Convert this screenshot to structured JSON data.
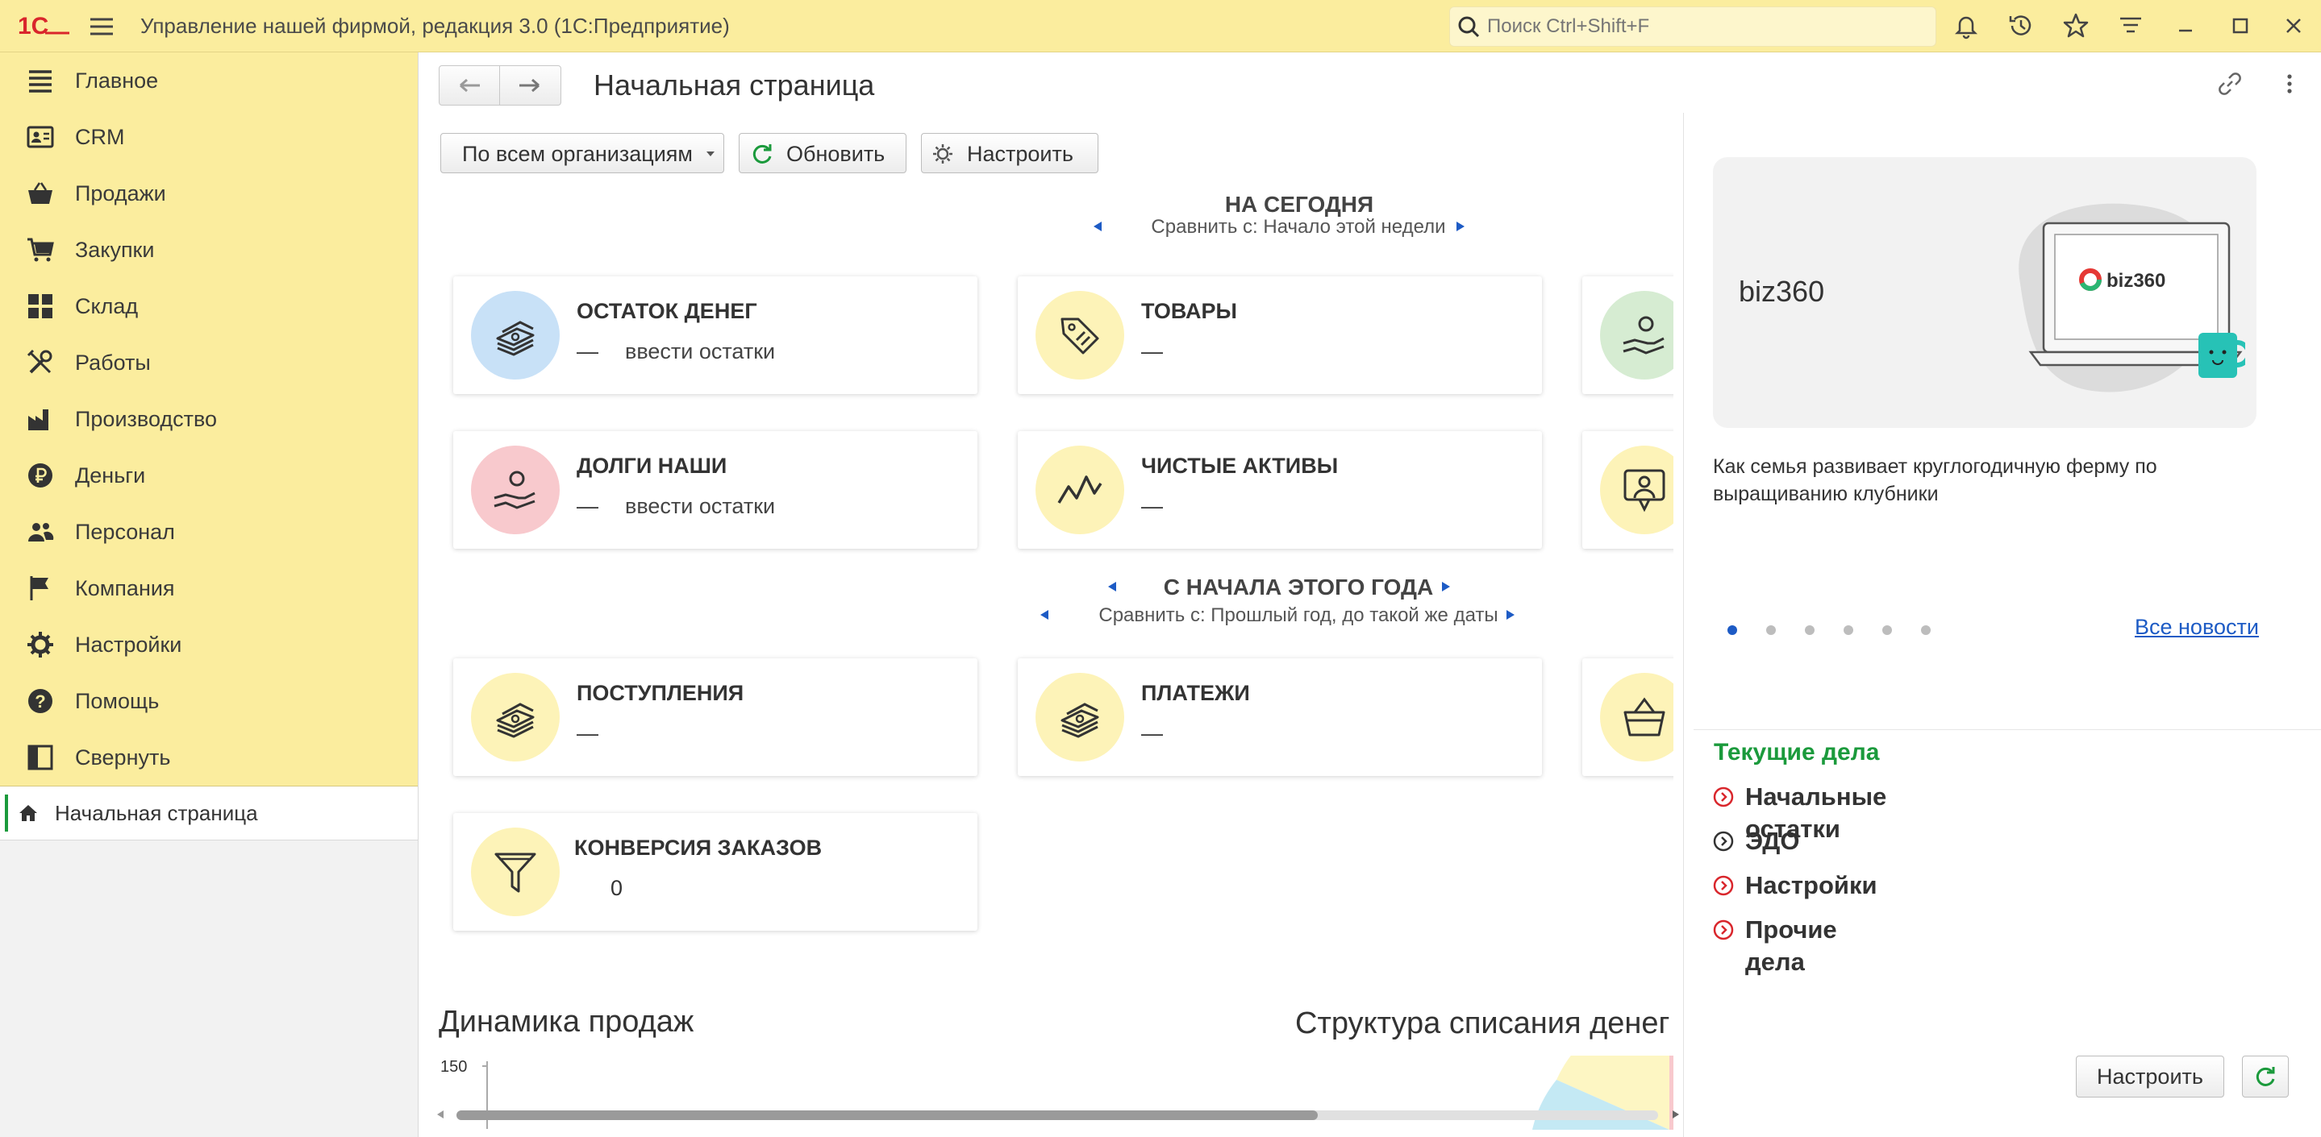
{
  "app": {
    "title": "Управление нашей фирмой, редакция 3.0  (1С:Предприятие)",
    "logo_text": "1С"
  },
  "search": {
    "placeholder": "Поиск Ctrl+Shift+F"
  },
  "sidebar": {
    "sections": [
      {
        "label": "Главное",
        "icon": "list-icon"
      },
      {
        "label": "CRM",
        "icon": "contact-card-icon"
      },
      {
        "label": "Продажи",
        "icon": "basket-icon"
      },
      {
        "label": "Закупки",
        "icon": "cart-icon"
      },
      {
        "label": "Склад",
        "icon": "warehouse-grid-icon"
      },
      {
        "label": "Работы",
        "icon": "tools-icon"
      },
      {
        "label": "Производство",
        "icon": "factory-icon"
      },
      {
        "label": "Деньги",
        "icon": "ruble-icon"
      },
      {
        "label": "Персонал",
        "icon": "people-icon"
      },
      {
        "label": "Компания",
        "icon": "flag-icon"
      },
      {
        "label": "Настройки",
        "icon": "gear-icon"
      },
      {
        "label": "Помощь",
        "icon": "help-icon"
      },
      {
        "label": "Свернуть",
        "icon": "collapse-panel-icon"
      }
    ],
    "open_page": "Начальная страница"
  },
  "main": {
    "title": "Начальная страница",
    "toolbar": {
      "org_select": "По всем организациям",
      "refresh": "Обновить",
      "configure": "Настроить"
    },
    "today": {
      "heading": "НА СЕГОДНЯ",
      "compare": "Сравнить с: Начало этой недели"
    },
    "year": {
      "heading": "С НАЧАЛА ЭТОГО ГОДА",
      "compare": "Сравнить с: Прошлый год, до такой же даты"
    },
    "cards": {
      "cash": {
        "title": "ОСТАТОК ДЕНЕГ",
        "value": "—",
        "note": "ввести остатки"
      },
      "goods": {
        "title": "ТОВАРЫ",
        "value": "—"
      },
      "debts": {
        "title": "ДОЛГИ НАШИ",
        "value": "—",
        "note": "ввести остатки"
      },
      "assets": {
        "title": "ЧИСТЫЕ АКТИВЫ",
        "value": "—"
      },
      "income": {
        "title": "ПОСТУПЛЕНИЯ",
        "value": "—"
      },
      "payments": {
        "title": "ПЛАТЕЖИ",
        "value": "—"
      },
      "conversion": {
        "title": "КОНВЕРСИЯ ЗАКАЗОВ",
        "value": "0"
      }
    },
    "charts": {
      "sales_title": "Динамика продаж",
      "sales_ytick": "150",
      "writeoff_title": "Структура списания денег"
    }
  },
  "right": {
    "news": {
      "brand": "biz360",
      "logo_text": "biz360",
      "text": "Как семья развивает круглогодичную ферму по выращиванию клубники",
      "all_news": "Все новости",
      "pages": 6,
      "active_page": 1
    },
    "tasks": {
      "title": "Текущие дела",
      "items": [
        {
          "label": "Начальные остатки",
          "status": "red"
        },
        {
          "label": "ЭДО",
          "status": "gray"
        },
        {
          "label": "Настройки",
          "status": "red"
        },
        {
          "label": "Прочие дела",
          "status": "red"
        }
      ]
    },
    "configure": "Настроить"
  },
  "colors": {
    "accent_yellow": "#fbed9e",
    "green": "#1b9a3c",
    "red": "#d9262c",
    "link": "#1d5bc5"
  }
}
